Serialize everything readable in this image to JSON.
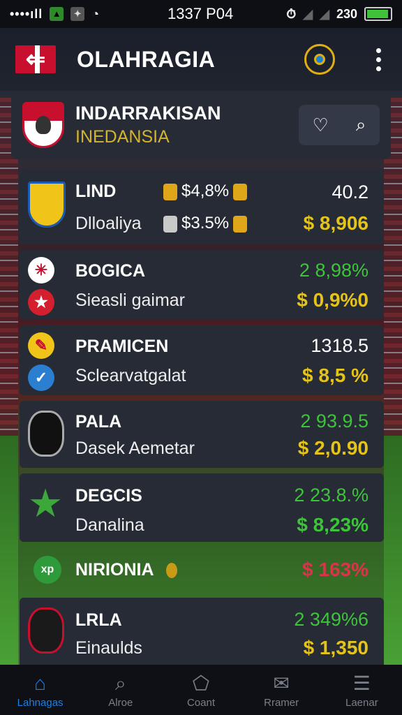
{
  "statusbar": {
    "signal": "••••ıll",
    "time": "1337 P04",
    "right_num": "230"
  },
  "header": {
    "title": "OLAHRAGIA"
  },
  "team": {
    "name": "INDARRAKISAN",
    "subtitle": "INEDANSIA"
  },
  "rows": [
    {
      "name": "LIND",
      "sub": "Dlloaliya",
      "mid1": "$4,8%",
      "mid2": "$3.5%",
      "val1": "40.2",
      "val2": "$ 8,906",
      "val1_color": "white",
      "val2_color": "gold"
    },
    {
      "name": "BOGICA",
      "sub": "Sieasli gaimar",
      "val1": "2 8,98%",
      "val2": "$ 0,9%0",
      "val1_color": "green",
      "val2_color": "gold"
    },
    {
      "name": "PRAMICEN",
      "sub": "Sclearvatgalat",
      "val1": "1318.5",
      "val2": "$ 8,5 %",
      "val1_color": "white",
      "val2_color": "gold"
    },
    {
      "name": "PALA",
      "sub": "Dasek Aemetar",
      "val1": "2 93.9.5",
      "val2": "$ 2,0.90",
      "val1_color": "green",
      "val2_color": "gold"
    },
    {
      "name": "DEGCIS",
      "sub": "Danalina",
      "val1": "2 23.8.%",
      "val2": "$ 8,23%",
      "val1_color": "green",
      "val2_color": "green"
    },
    {
      "name": "NIRIONIA",
      "val2": "$ 163%",
      "val2_color": "red"
    },
    {
      "name": "LRLA",
      "sub": "Einaulds",
      "val1": "2 349%6",
      "val2": "$ 1,350",
      "val1_color": "green",
      "val2_color": "gold"
    }
  ],
  "nav": [
    {
      "label": "Lahnagas",
      "active": true
    },
    {
      "label": "Alroe"
    },
    {
      "label": "Coant"
    },
    {
      "label": "Rramer"
    },
    {
      "label": "Laenar"
    }
  ],
  "icons": {
    "back": "back-arrow-icon",
    "profile": "profile-icon",
    "more": "kebab-menu-icon",
    "favorite": "heart-icon",
    "search": "search-icon"
  },
  "colors": {
    "accent_blue": "#1d7fe0",
    "gold": "#e4c31a",
    "green": "#3ec43a",
    "red": "#d8354a",
    "card": "#262b36"
  }
}
